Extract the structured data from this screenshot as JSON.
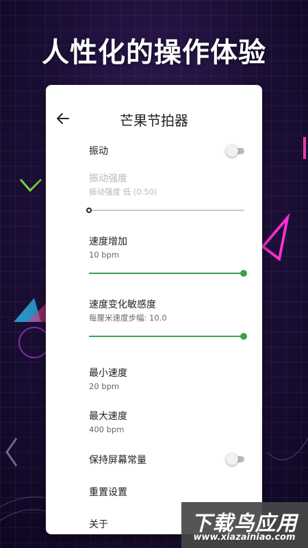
{
  "headline": "人性化的操作体验",
  "app": {
    "title": "芒果节拍器",
    "settings": [
      {
        "label": "振动",
        "type": "toggle",
        "on": false
      },
      {
        "label": "振动强度",
        "sub": "振动强度 低 (0.50)",
        "type": "slider",
        "enabled": false,
        "level": 0.0
      },
      {
        "label": "速度增加",
        "sub": "10 bpm",
        "type": "slider",
        "enabled": true,
        "level": 1.0
      },
      {
        "label": "速度变化敏感度",
        "sub": "每厘米速度步幅: 10.0",
        "type": "slider",
        "enabled": true,
        "level": 1.0
      },
      {
        "label": "最小速度",
        "sub": "20 bpm"
      },
      {
        "label": "最大速度",
        "sub": "400 bpm"
      },
      {
        "label": "保持屏幕常量",
        "type": "toggle",
        "on": false
      },
      {
        "label": "重置设置"
      },
      {
        "label": "关于"
      }
    ]
  },
  "colors": {
    "accent": "#3aa04a",
    "background": "#1d0f38"
  },
  "watermark": {
    "main": "下载鸟应用",
    "sub": "www.xiazainiao.com"
  }
}
